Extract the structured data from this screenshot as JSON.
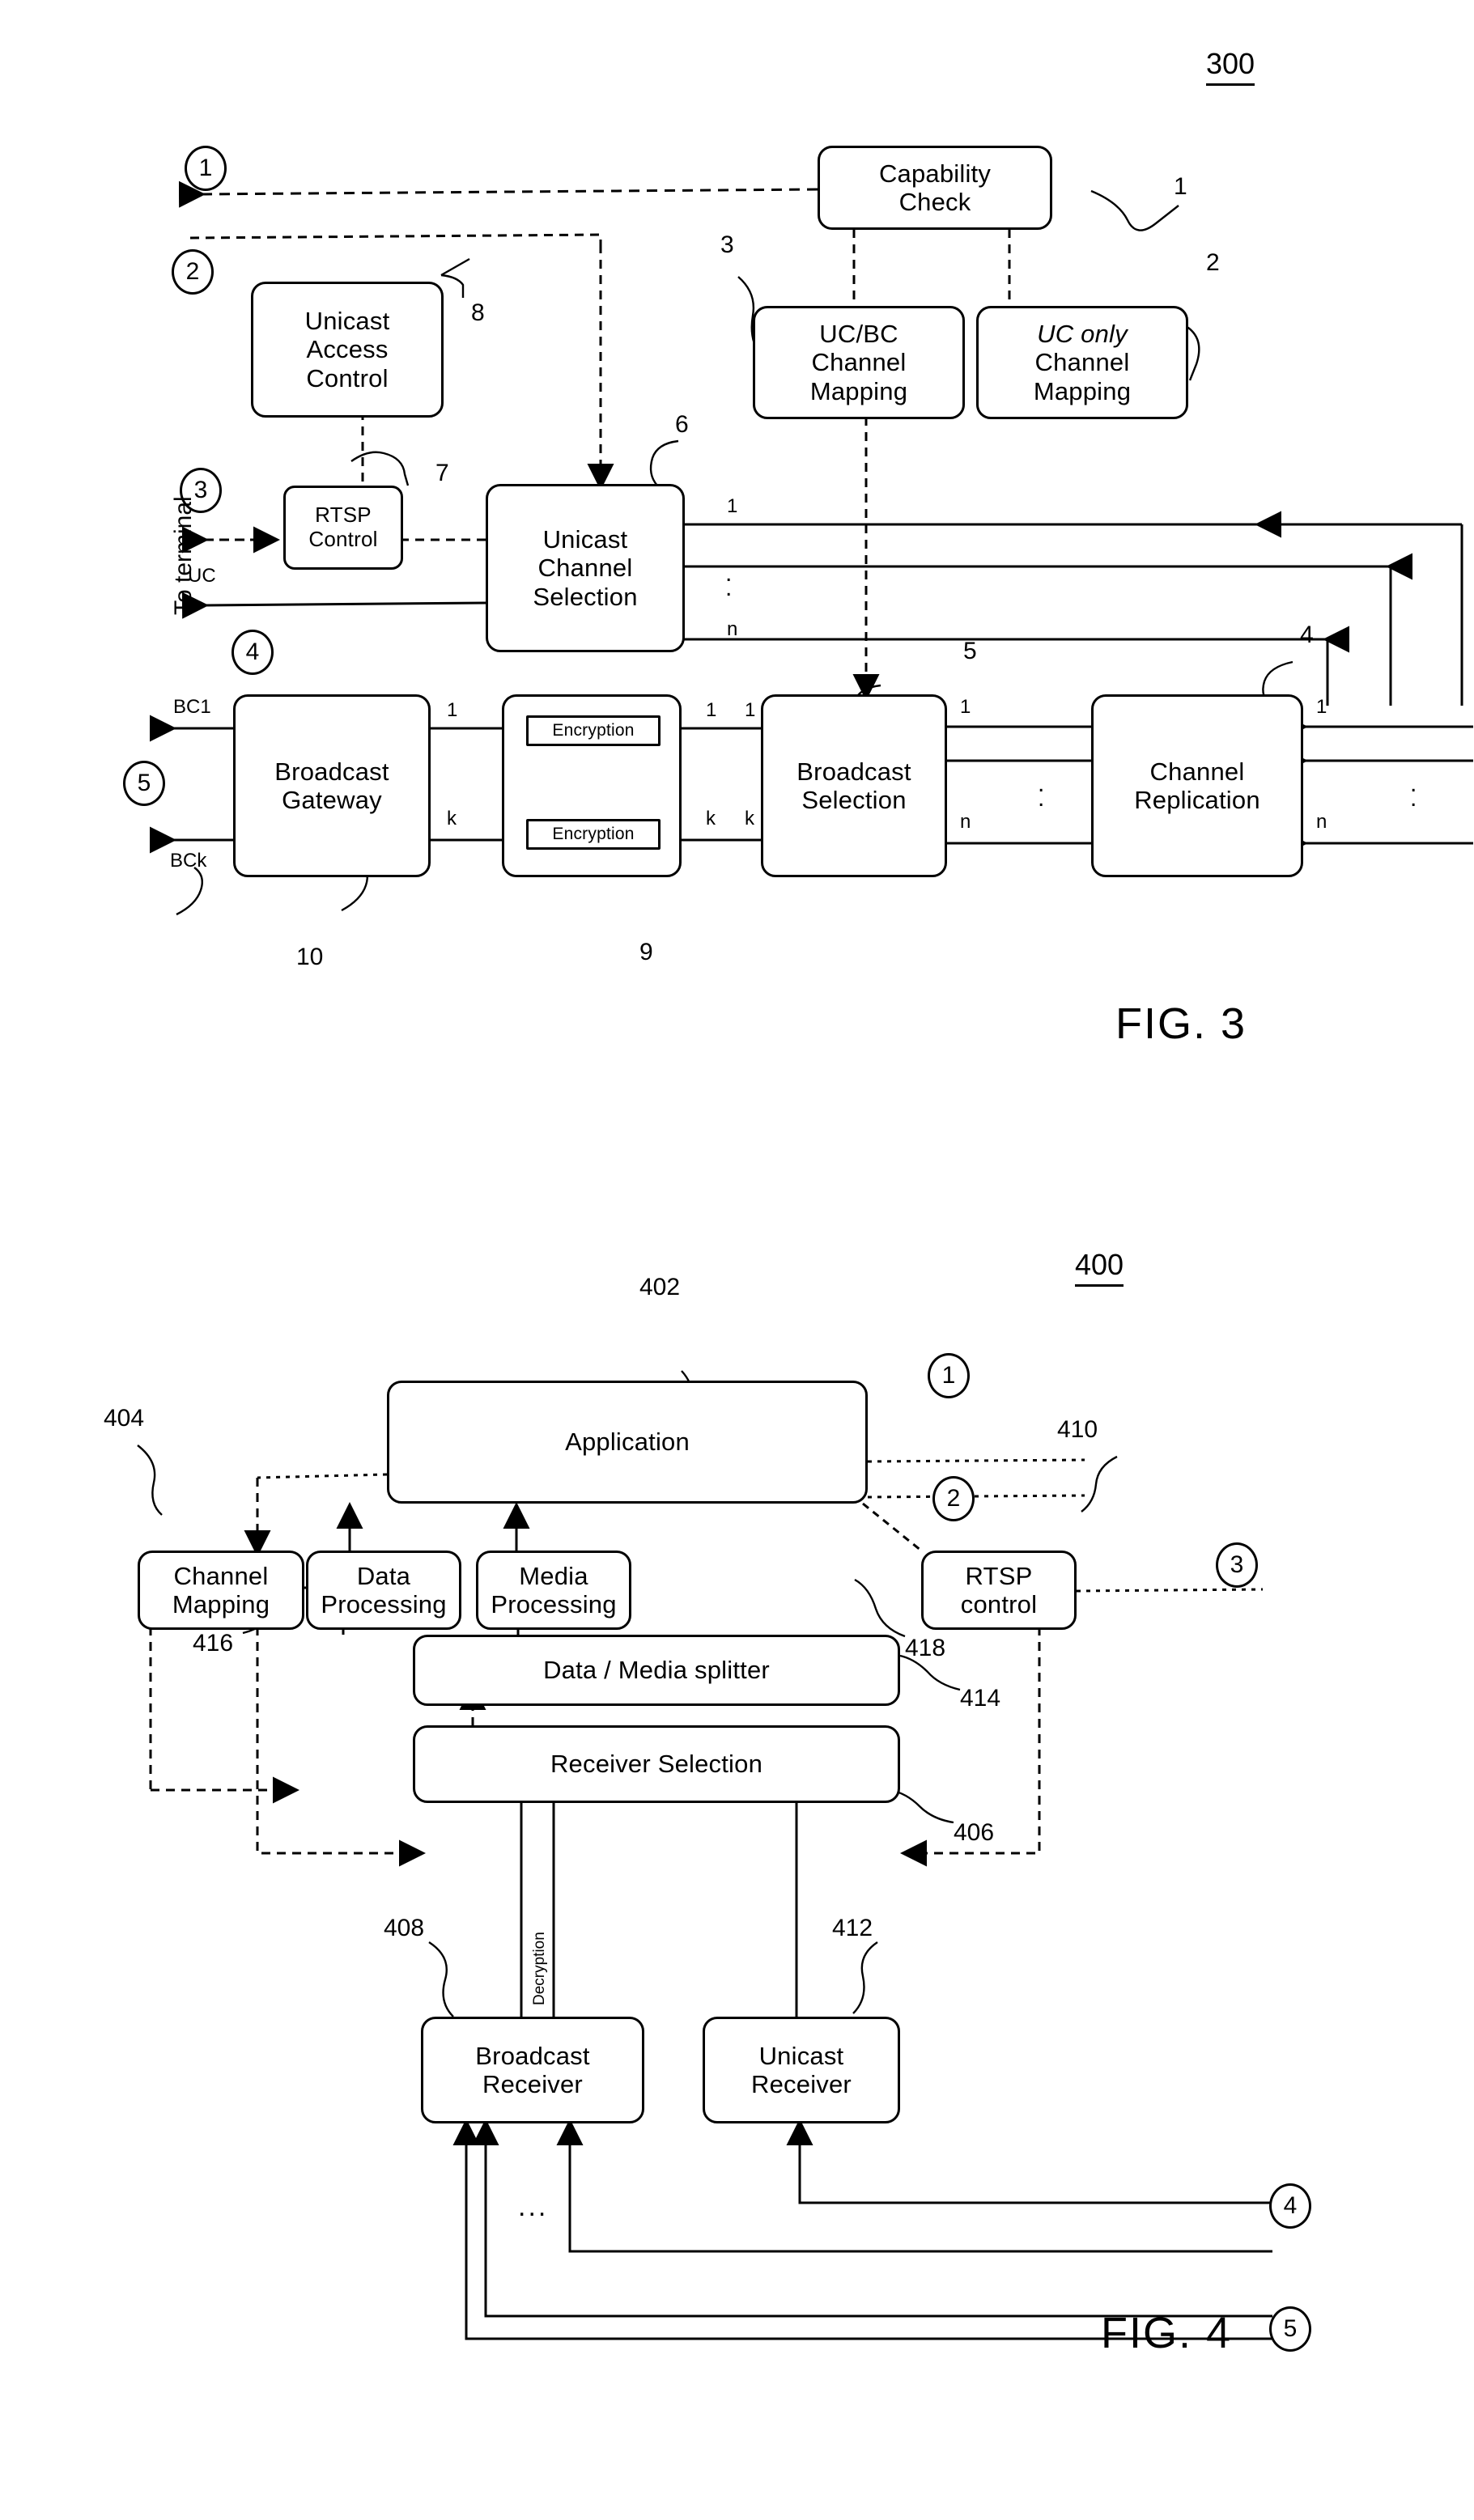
{
  "figures": [
    {
      "id": "fig3",
      "number_label": "300",
      "caption": "FIG. 3",
      "boxes": [
        {
          "key": "capability_check",
          "label": "Capability\nCheck",
          "ref": "1"
        },
        {
          "key": "ucbc_channel_mapping",
          "label": "UC/BC\nChannel\nMapping",
          "ref": "3"
        },
        {
          "key": "uconly_channel_mapping",
          "label_plain": "Channel\nMapping",
          "label_italic": "UC only",
          "ref": "2"
        },
        {
          "key": "unicast_access_control",
          "label": "Unicast\nAccess\nControl",
          "ref": "8"
        },
        {
          "key": "rtsp_control",
          "label": "RTSP\nControl",
          "ref": "7"
        },
        {
          "key": "unicast_channel_selection",
          "label": "Unicast\nChannel\nSelection",
          "ref": "6"
        },
        {
          "key": "broadcast_gateway",
          "label": "Broadcast\nGateway",
          "ref": "10"
        },
        {
          "key": "encryption_stack",
          "label": "",
          "ref": "9"
        },
        {
          "key": "broadcast_selection",
          "label": "Broadcast\nSelection",
          "ref": "5"
        },
        {
          "key": "channel_replication",
          "label": "Channel\nReplication",
          "ref": "4"
        }
      ],
      "encryption_blocks": [
        "Encryption",
        "Encryption"
      ],
      "step_circles": [
        "1",
        "2",
        "3",
        "4",
        "5"
      ],
      "side_label": "To terminal",
      "uc_label": "UC",
      "output_labels": [
        "BC1",
        "BCk"
      ],
      "port_labels": {
        "ucs_in_first": "1",
        "ucs_in_last": "n",
        "bgw_in_first": "1",
        "bgw_in_last": "k",
        "enc_in_first": "1",
        "enc_in_last": "k",
        "bsel_in_first": "1",
        "bsel_in_last": "n",
        "bsel_left_first": "1",
        "bsel_left_last": "k",
        "crep_in_first": "1",
        "crep_in_last": "n",
        "vertical_dots": ":"
      }
    },
    {
      "id": "fig4",
      "number_label": "400",
      "caption": "FIG. 4",
      "boxes": [
        {
          "key": "application",
          "label": "Application",
          "ref": "402"
        },
        {
          "key": "channel_mapping",
          "label": "Channel\nMapping",
          "ref": "404"
        },
        {
          "key": "data_processing",
          "label": "Data\nProcessing",
          "ref": "416"
        },
        {
          "key": "media_processing",
          "label": "Media\nProcessing",
          "ref": "418"
        },
        {
          "key": "rtsp_control",
          "label": "RTSP\ncontrol",
          "ref": "410"
        },
        {
          "key": "data_media_splitter",
          "label": "Data / Media splitter",
          "ref": "414"
        },
        {
          "key": "receiver_selection",
          "label": "Receiver Selection",
          "ref": "406"
        },
        {
          "key": "broadcast_receiver",
          "label": "Broadcast\nReceiver",
          "ref": "408"
        },
        {
          "key": "unicast_receiver",
          "label": "Unicast\nReceiver",
          "ref": "412"
        }
      ],
      "decryption_label": "Decryption",
      "step_circles": [
        "1",
        "2",
        "3",
        "4",
        "5"
      ],
      "ellipsis": "..."
    }
  ]
}
